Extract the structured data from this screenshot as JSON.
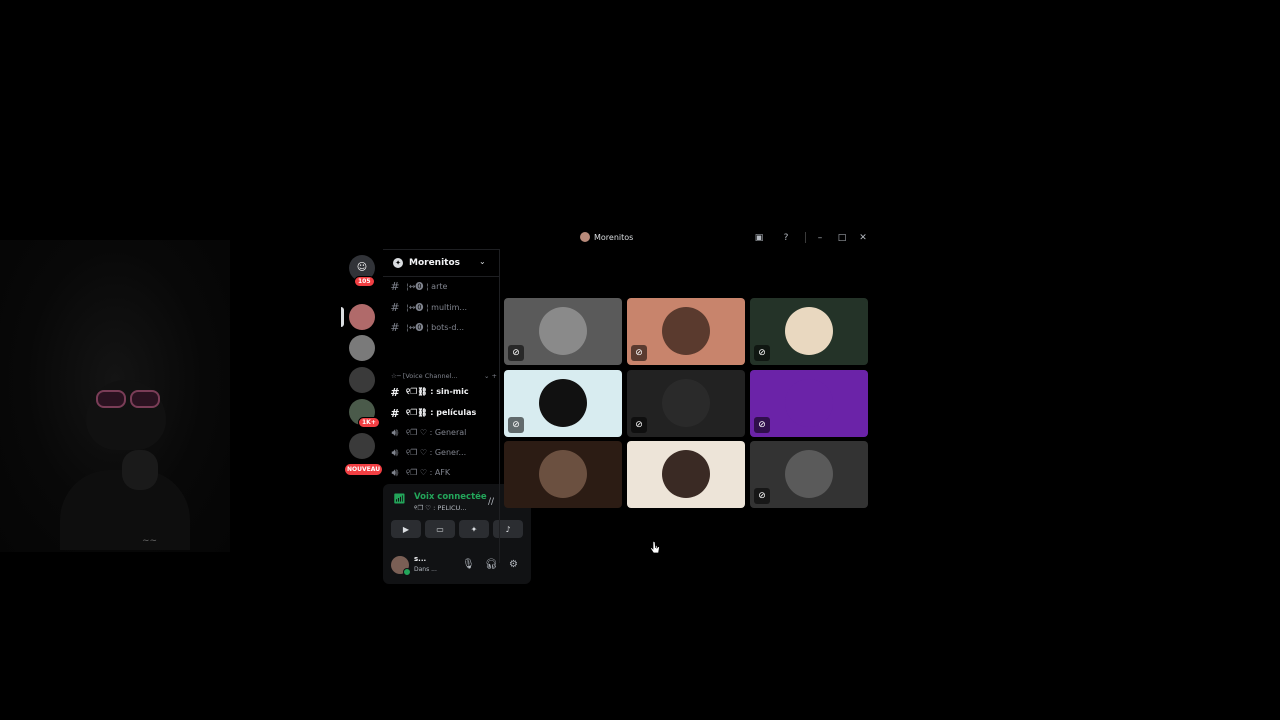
{
  "window": {
    "title": "Morenitos"
  },
  "servers": {
    "dm_badge": "105",
    "community_badge": "1K+",
    "new_label": "NOUVEAU"
  },
  "sidebar": {
    "guild_name": "Morenitos",
    "channels": [
      {
        "label": "¦↭⓿ ¦ arte",
        "type": "text",
        "active": false
      },
      {
        "label": "¦↭⓿ ¦ multim...",
        "type": "text",
        "active": false
      },
      {
        "label": "¦↭⓿ ¦ bots-d...",
        "type": "text",
        "active": false
      }
    ],
    "category": "☆─ [Voice Channel...",
    "voice_channels": [
      {
        "label": "୧❐⛓ : sin-mic",
        "type": "text",
        "active": true
      },
      {
        "label": "୧❐⛓ : películas",
        "type": "text",
        "active": true
      },
      {
        "label": "୧❐ ♡ : General",
        "type": "voice",
        "active": false
      },
      {
        "label": "୧❐ ♡ : Gener...",
        "type": "voice",
        "active": false
      },
      {
        "label": "୧❐ ♡ : AFK",
        "type": "voice",
        "active": false
      }
    ]
  },
  "voice_panel": {
    "status": "Voix connectée",
    "channel": "୧❐ ♡ : PELICU..."
  },
  "user": {
    "name": "s...",
    "status": "Dans ..."
  },
  "participants": [
    {
      "muted": true,
      "bg": "#5a5a5a",
      "avatar": "#8a8a8a"
    },
    {
      "muted": true,
      "bg": "#c8846c",
      "avatar": "#5a3a2e"
    },
    {
      "muted": true,
      "bg": "#243328",
      "avatar": "#e9d8c0"
    },
    {
      "muted": true,
      "bg": "#d8ecf0",
      "avatar": "#111111"
    },
    {
      "muted": true,
      "bg": "#222222",
      "avatar": "#2a2a2a"
    },
    {
      "muted": true,
      "bg": "#6b23a8",
      "avatar": "#6b23a8"
    },
    {
      "muted": false,
      "bg": "#2c1c14",
      "avatar": "#6b5040"
    },
    {
      "muted": false,
      "bg": "#ede4d8",
      "avatar": "#3a2a24"
    },
    {
      "muted": true,
      "bg": "#333333",
      "avatar": "#5a5a5a"
    }
  ]
}
